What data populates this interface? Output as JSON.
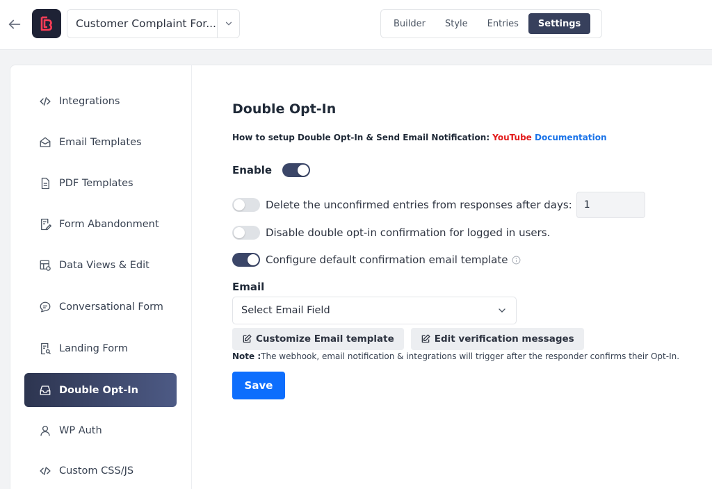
{
  "header": {
    "form_name": "Customer Complaint For...",
    "tabs": [
      {
        "label": "Builder",
        "active": false
      },
      {
        "label": "Style",
        "active": false
      },
      {
        "label": "Entries",
        "active": false
      },
      {
        "label": "Settings",
        "active": true
      }
    ]
  },
  "sidebar": {
    "items": [
      {
        "label": "Integrations",
        "icon": "code-icon"
      },
      {
        "label": "Email Templates",
        "icon": "envelope-open-icon"
      },
      {
        "label": "PDF Templates",
        "icon": "document-icon"
      },
      {
        "label": "Form Abandonment",
        "icon": "document-edit-icon"
      },
      {
        "label": "Data Views & Edit",
        "icon": "table-settings-icon"
      },
      {
        "label": "Conversational Form",
        "icon": "chat-bubble-icon"
      },
      {
        "label": "Landing Form",
        "icon": "document-search-icon"
      },
      {
        "label": "Double Opt-In",
        "icon": "inbox-icon",
        "active": true
      },
      {
        "label": "WP Auth",
        "icon": "user-icon"
      },
      {
        "label": "Custom CSS/JS",
        "icon": "code-icon"
      }
    ]
  },
  "main": {
    "title": "Double Opt-In",
    "howto_text": "How to setup Double Opt-In & Send Email Notification: ",
    "youtube_link": "YouTube",
    "documentation_link": "Documentation",
    "enable_label": "Enable",
    "enable_on": true,
    "delete_unconfirmed_label": "Delete the unconfirmed entries from responses after days:",
    "delete_unconfirmed_on": false,
    "days_value": "1",
    "disable_logged_in_label": "Disable double opt-in confirmation for logged in users.",
    "disable_logged_in_on": false,
    "configure_template_label": "Configure default confirmation email template",
    "configure_template_on": true,
    "email_label": "Email",
    "email_select_value": "Select Email Field",
    "customize_button": "Customize Email template",
    "edit_messages_button": "Edit verification messages",
    "note_prefix": "Note :",
    "note_text": "The webhook, email notification & integrations will trigger after the responder confirms their Opt-In.",
    "save_button": "Save"
  },
  "colors": {
    "accent_dark": "#37405c",
    "primary_blue": "#0d6efd",
    "youtube_red": "#e21b1b",
    "link_blue": "#1a73e8"
  }
}
